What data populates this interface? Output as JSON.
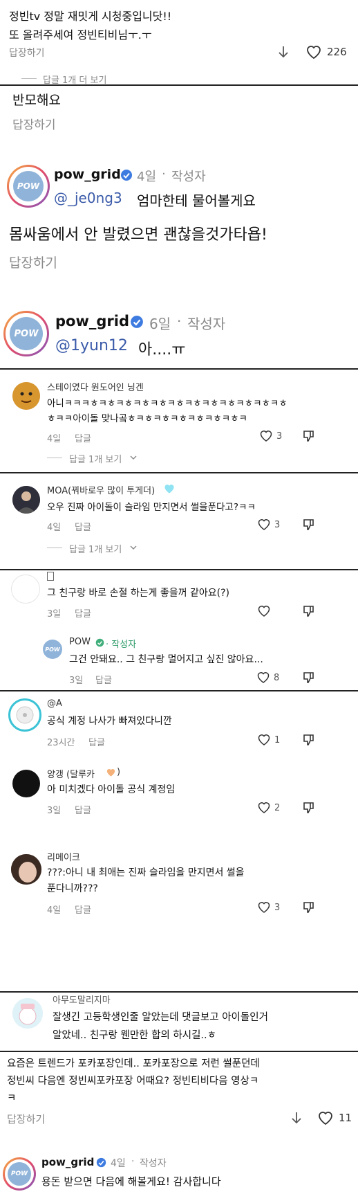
{
  "block1": {
    "line1": "정빈tv 정말 재밋게 시청중입니닷!!",
    "line2": "또 올려주세여 정빈티비님ㅜ.ㅜ",
    "reply": "답장하기",
    "likes": "226",
    "more_replies": "답글 1개 더 보기"
  },
  "block2": {
    "text": "반모해요",
    "reply": "답장하기",
    "author": "pow_grid",
    "time": "4일",
    "dot": "·",
    "author_tag": "작성자",
    "mention": "@_je0ng3",
    "body": "엄마한테 물어볼게요"
  },
  "block3": {
    "text": "몸싸움에서 안 발렸으면 괜찮을것가타욥!",
    "reply": "답장하기",
    "author": "pow_grid",
    "time": "6일",
    "dot": "·",
    "author_tag": "작성자",
    "mention": "@1yun12",
    "body": "아....ㅠ"
  },
  "comment_a": {
    "user": "스테이였다 원도어인 닝겐",
    "line1": "아니ㅋㅋㅋㅎㅋㅎㅋㅎㅋㅎㅋㅎㅋㅎㅋㅎㅋㅎㅋㅎㅋㅎㅋㅎㅋㅎ",
    "line2": "ㅎㅋㅋ아이돌 맞나곸ㅎㅋㅎㅋㅎㅋㅎㅋㅎㅋㅎㅋㅎㅋ",
    "time": "4일",
    "reply": "답글",
    "likes": "3",
    "more": "답글 1개 보기"
  },
  "comment_b": {
    "user": "MOA(꿔바로우 많이 투게더)",
    "text": "오우 진짜 아이돌이 슬라임 만지면서 썰을푼다고?ㅋㅋ",
    "time": "4일",
    "reply": "답글",
    "likes": "3",
    "more": "답글 1개 보기"
  },
  "comment_c": {
    "text": "그 친구랑 바로 손절 하는게 좋을꺼 같아요(?)",
    "time": "3일",
    "reply": "답글",
    "pow_user": "POW",
    "pow_tag": "· 작성자",
    "pow_text": "그건 안돼요.. 그 친구랑 멀어지고 싶진 않아요...",
    "pow_time": "3일",
    "pow_reply": "답글",
    "pow_likes": "8"
  },
  "comment_d": {
    "user": "@A",
    "text": "공식 계정 나사가 빠져있다니깐",
    "time": "23시간",
    "reply": "답글",
    "likes": "1"
  },
  "comment_e": {
    "user": "양갱 (달루카",
    "user_end": ")",
    "text": "아 미치겠다 아이돌 공식 계정임",
    "time": "3일",
    "reply": "답글",
    "likes": "2"
  },
  "comment_f": {
    "user": "리메이크",
    "line1": "???:아니 내 최애는 진짜 슬라임을 만지면서 썰을",
    "line2": "푼다니까???",
    "time": "4일",
    "reply": "답글",
    "likes": "3"
  },
  "comment_g": {
    "user": "아무도말리지마",
    "line1": "잘생긴 고등학생인줄 알았는데 댓글보고 아이돌인거",
    "line2": "알았네.. 친구랑 웬만한 합의 하시길..ㅎ"
  },
  "block4": {
    "line1": "요즘은 트렌드가 포카포장인데.. 포카포장으로 저런 썰푼던데",
    "line2": "정빈씨 다음엔 정빈씨포카포장 어때요? 정빈티비다음 영상ㅋ",
    "line3": "ㅋ",
    "reply": "답장하기",
    "likes": "11",
    "author": "pow_grid",
    "time": "4일",
    "dot": "·",
    "author_tag": "작성자",
    "body": "용돈 받으면 다음에 해볼게요! 감사합니다"
  },
  "logo_text": "POW",
  "colors": {
    "verified": "#3d7be0",
    "mention": "#3b5ba9",
    "divider": "#222222",
    "muted": "#8a8a8a"
  }
}
